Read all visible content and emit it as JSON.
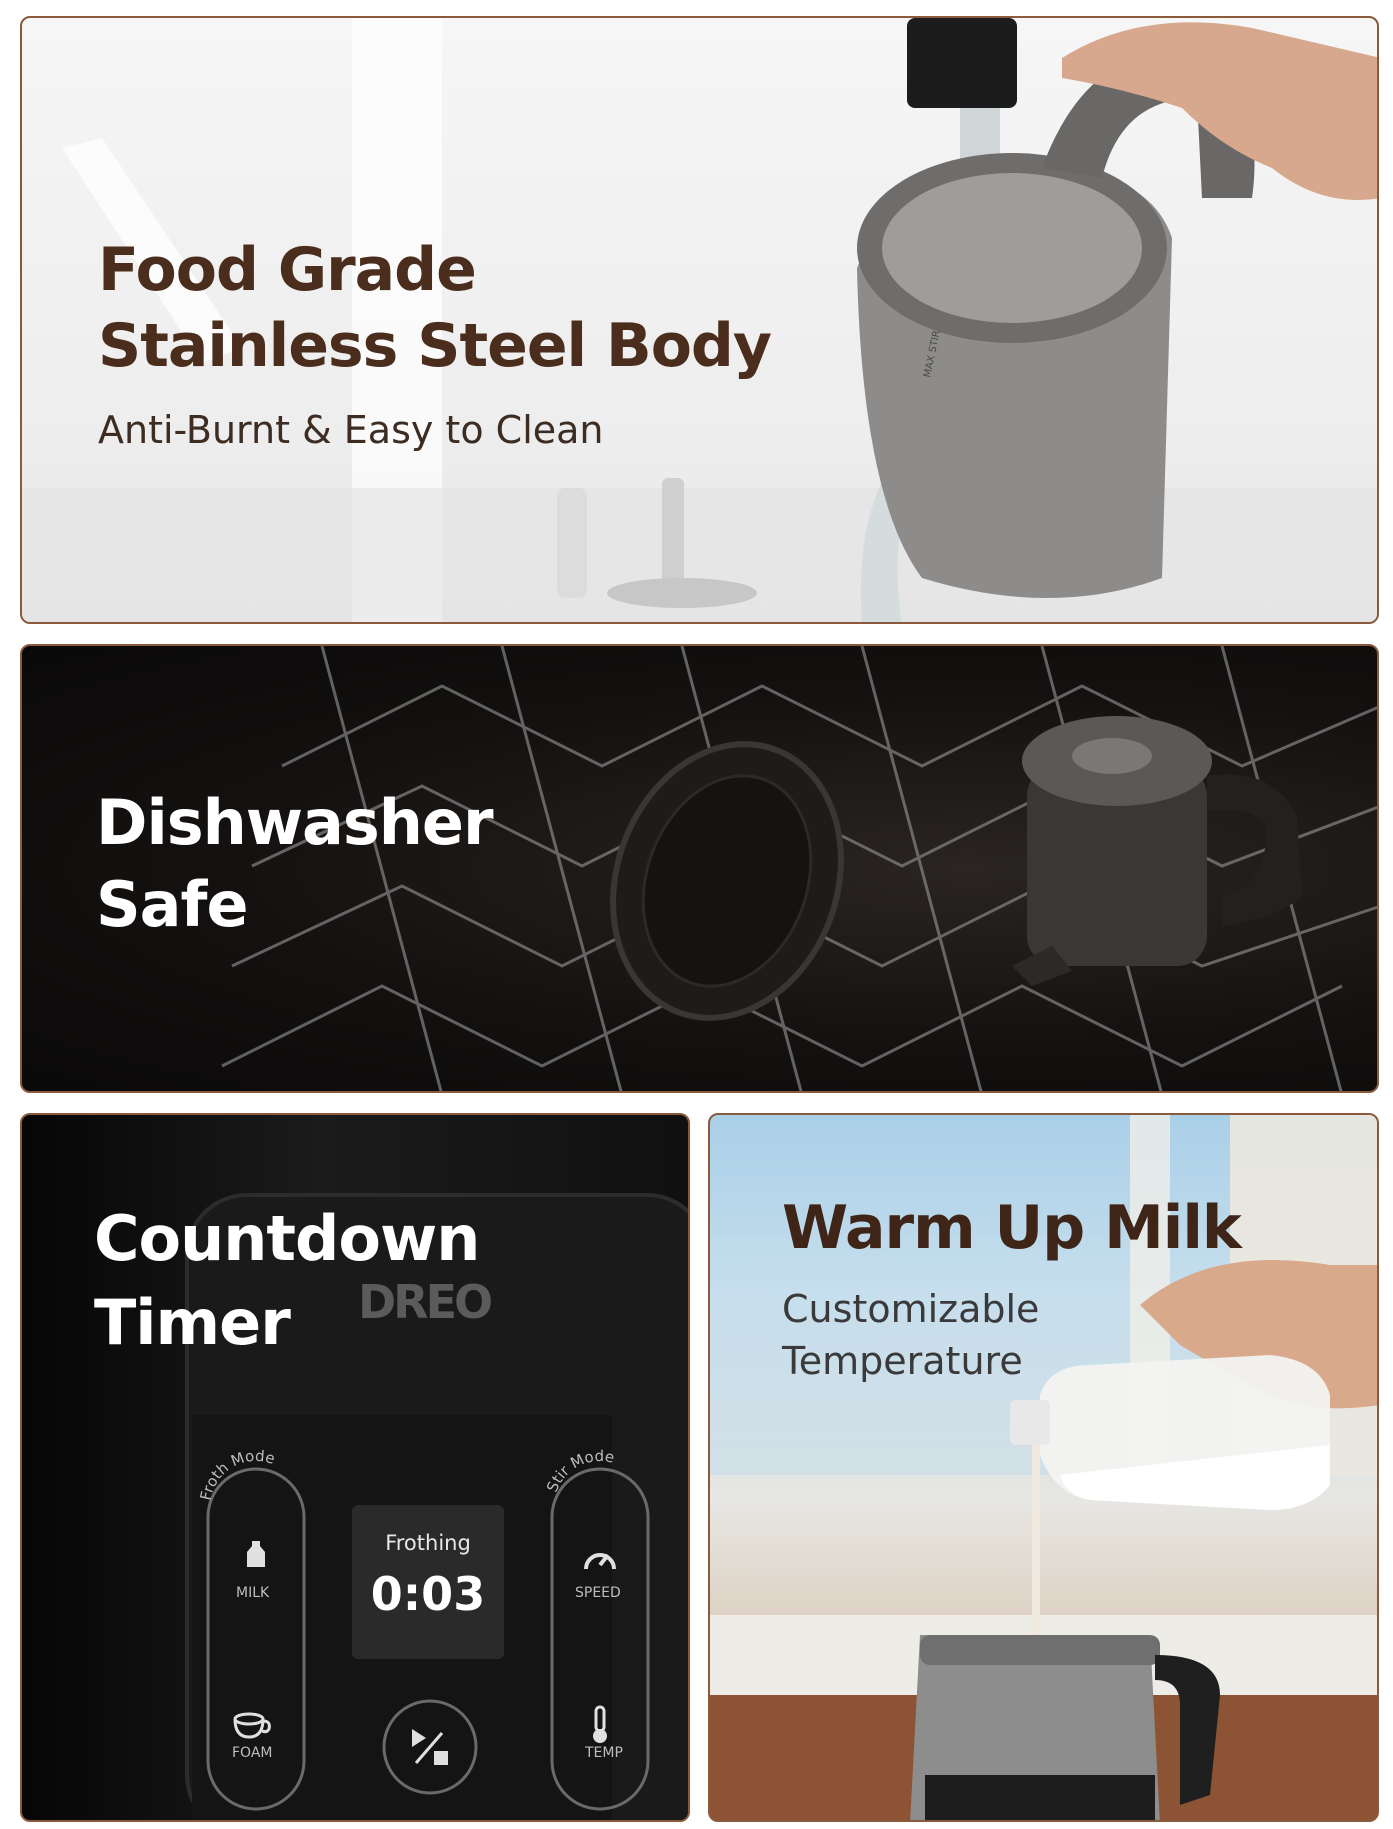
{
  "panels": {
    "stainless": {
      "title_line1": "Food Grade",
      "title_line2": "Stainless Steel Body",
      "subtitle": "Anti-Burnt & Easy to Clean",
      "jug_marking": "MAX STIR"
    },
    "dishwasher": {
      "title_line1": "Dishwasher",
      "title_line2": "Safe"
    },
    "timer": {
      "title_line1": "Countdown",
      "title_line2": "Timer",
      "brand": "DREO",
      "froth_mode_label": "Froth Mode",
      "stir_mode_label": "Stir Mode",
      "milk_label": "MILK",
      "foam_label": "FOAM",
      "speed_label": "SPEED",
      "temp_label": "TEMP",
      "display_mode": "Frothing",
      "display_time": "0:03",
      "icons": [
        "milk-bottle-icon",
        "cup-icon",
        "play-stop-icon",
        "speed-gauge-icon",
        "thermometer-icon"
      ]
    },
    "warm": {
      "title": "Warm Up Milk",
      "subtitle_line1": "Customizable",
      "subtitle_line2": "Temperature"
    }
  },
  "colors": {
    "border": "#8b5a3c",
    "title_brown": "#4a2d1c",
    "white_text": "#ffffff"
  }
}
